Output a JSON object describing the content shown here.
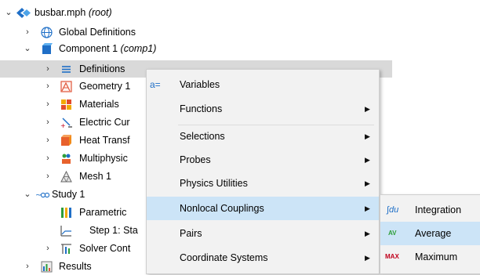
{
  "tree": {
    "root_label": "busbar.mph",
    "root_suffix": "(root)",
    "global_definitions": "Global Definitions",
    "component_label": "Component 1",
    "component_suffix": "(comp1)",
    "definitions": "Definitions",
    "geometry": "Geometry 1",
    "materials": "Materials",
    "electric": "Electric Cur",
    "heat": "Heat Transf",
    "multiphysics": "Multiphysic",
    "mesh": "Mesh 1",
    "study": "Study 1",
    "parametric": "Parametric",
    "step": "Step 1: Sta",
    "solver": "Solver Cont",
    "results": "Results"
  },
  "context_menu": {
    "variables": "Variables",
    "functions": "Functions",
    "selections": "Selections",
    "probes": "Probes",
    "physics_utilities": "Physics Utilities",
    "nonlocal_couplings": "Nonlocal Couplings",
    "pairs": "Pairs",
    "coordinate_systems": "Coordinate Systems",
    "variables_icon_text": "a="
  },
  "submenu": {
    "integration": "Integration",
    "average": "Average",
    "maximum": "Maximum",
    "integration_icon_text": "∫du",
    "average_icon_text": "AV",
    "maximum_icon_text": "MAX"
  },
  "colors": {
    "selection_gray": "#d9d9d9",
    "menu_bg": "#f2f2f2",
    "menu_highlight": "#cce4f7",
    "comsol_blue": "#1f6fc7",
    "max_red": "#c0001b",
    "av_green": "#2e9e3a"
  }
}
